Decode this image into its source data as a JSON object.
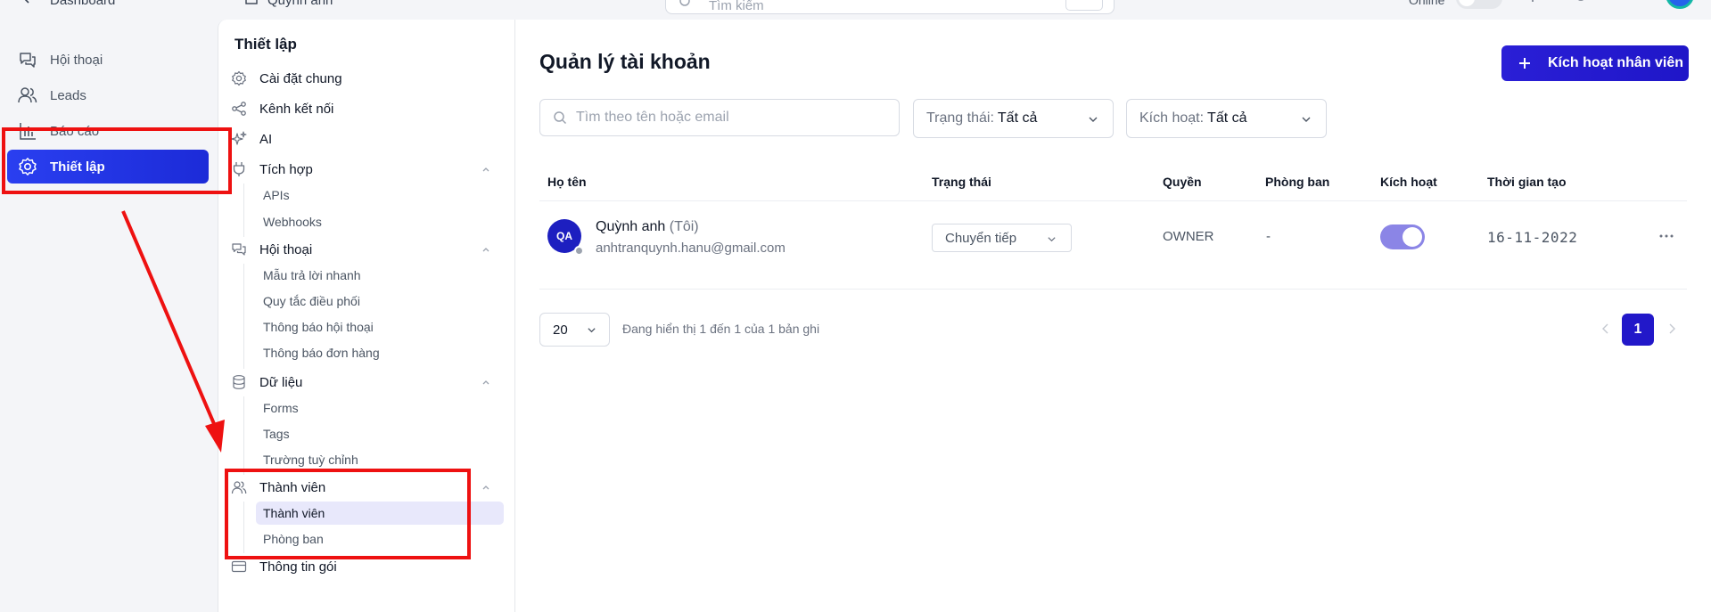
{
  "topbar": {
    "back_label": "Dashboard",
    "workspace_label": "Quỳnh anh",
    "search_placeholder": "Tìm kiếm",
    "status_label": "Online"
  },
  "main_nav": {
    "items": [
      {
        "label": "Hội thoại",
        "icon": "chat-icon"
      },
      {
        "label": "Leads",
        "icon": "users-icon"
      },
      {
        "label": "Báo cáo",
        "icon": "bar-chart-icon"
      },
      {
        "label": "Thiết lập",
        "icon": "gear-icon",
        "active": true
      }
    ]
  },
  "settings": {
    "title": "Thiết lập",
    "items": {
      "general": "Cài đặt chung",
      "channels": "Kênh kết nối",
      "ai": "AI",
      "integrations": "Tích hợp",
      "apis": "APIs",
      "webhooks": "Webhooks",
      "conversations": "Hội thoại",
      "quick_replies": "Mẫu trả lời nhanh",
      "routing_rules": "Quy tắc điều phối",
      "conversation_notifications": "Thông báo hội thoại",
      "order_notifications": "Thông báo đơn hàng",
      "data": "Dữ liệu",
      "forms": "Forms",
      "tags": "Tags",
      "custom_fields": "Trường tuỳ chỉnh",
      "members": "Thành viên",
      "members_sub": "Thành viên",
      "departments": "Phòng ban",
      "plan_info": "Thông tin gói"
    }
  },
  "content": {
    "title": "Quản lý tài khoản",
    "add_button": "Kích hoạt nhân viên",
    "search_placeholder": "Tìm theo tên hoặc email",
    "filter_status_key": "Trạng thái:",
    "filter_status_value": "Tất cả",
    "filter_active_key": "Kích hoạt:",
    "filter_active_value": "Tất cả",
    "columns": [
      "Họ tên",
      "Trạng thái",
      "Quyền",
      "Phòng ban",
      "Kích hoạt",
      "Thời gian tạo"
    ],
    "rows": [
      {
        "initials": "QA",
        "name": "Quỳnh anh",
        "me_tag": "(Tôi)",
        "email": "anhtranquynh.hanu@gmail.com",
        "status": "Chuyển tiếp",
        "role": "OWNER",
        "department": "-",
        "active": true,
        "created": "16-11-2022"
      }
    ],
    "page_size": "20",
    "range_text": "Đang hiển thị 1 đến 1 của 1 bản ghi",
    "current_page": "1"
  },
  "colors": {
    "primary": "#2218c9",
    "active_nav": "#2a3ff0",
    "toggle_on": "#8b85e6",
    "annotation": "#ee1111"
  }
}
